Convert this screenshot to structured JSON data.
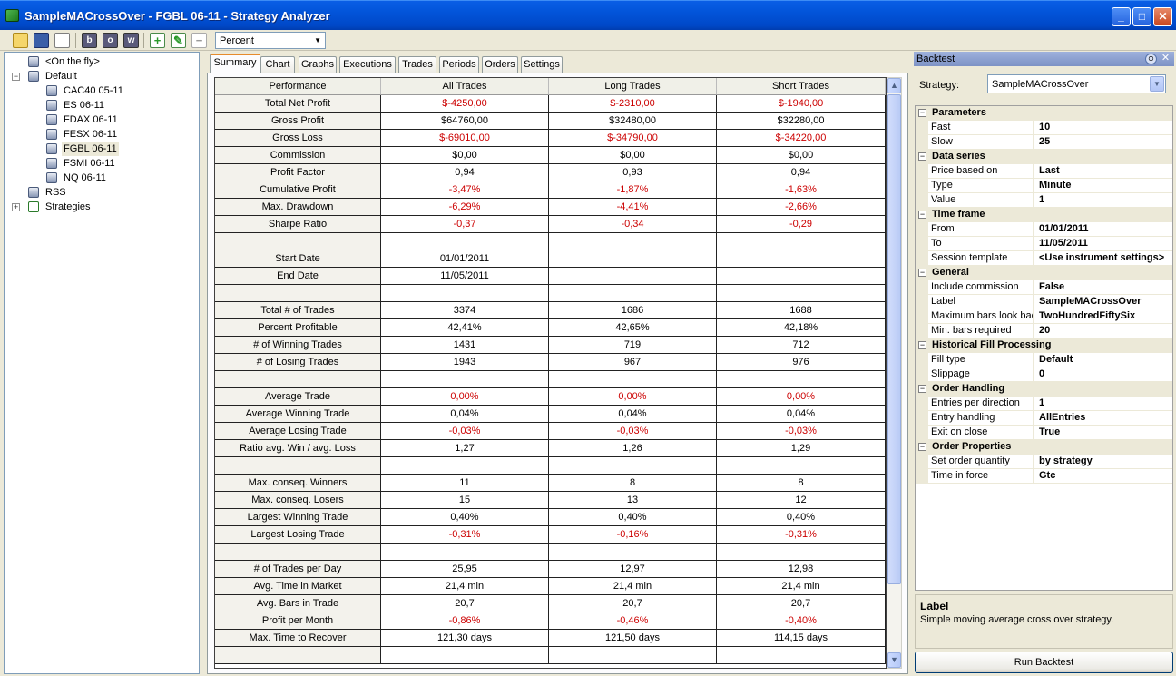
{
  "window": {
    "title": "SampleMACrossOver - FGBL 06-11 - Strategy Analyzer",
    "icon": "strategy-analyzer-icon",
    "controls": {
      "minimize": "_",
      "maximize": "□",
      "close": "✕"
    }
  },
  "toolbar": {
    "icons": [
      "open-folder-icon",
      "save-icon",
      "print-icon",
      "b-icon",
      "o-icon",
      "w-icon",
      "add-icon",
      "edit-icon",
      "remove-icon"
    ],
    "letters": {
      "b": "b",
      "o": "o",
      "w": "w",
      "add": "+",
      "edit": "✎",
      "remove": "−"
    },
    "display_select": {
      "value": "Percent",
      "arrow": "▼"
    }
  },
  "tree": {
    "expanders": {
      "default": "−",
      "strategies": "+"
    },
    "on_the_fly": "<On the fly>",
    "default": {
      "label": "Default",
      "items": [
        "CAC40 05-11",
        "ES 06-11",
        "FDAX 06-11",
        "FESX 06-11",
        "FGBL 06-11",
        "FSMI 06-11",
        "NQ 06-11"
      ],
      "selected": "FGBL 06-11"
    },
    "rss": "RSS",
    "strategies": "Strategies"
  },
  "tabs": [
    "Summary",
    "Chart",
    "Graphs",
    "Executions",
    "Trades",
    "Periods",
    "Orders",
    "Settings"
  ],
  "active_tab": "Summary",
  "summary": {
    "headers": [
      "Performance",
      "All Trades",
      "Long Trades",
      "Short Trades"
    ],
    "rows": [
      {
        "label": "Total Net Profit",
        "all": "$-4250,00",
        "long": "$-2310,00",
        "short": "$-1940,00",
        "neg": true
      },
      {
        "label": "Gross Profit",
        "all": "$64760,00",
        "long": "$32480,00",
        "short": "$32280,00"
      },
      {
        "label": "Gross Loss",
        "all": "$-69010,00",
        "long": "$-34790,00",
        "short": "$-34220,00",
        "neg": true
      },
      {
        "label": "Commission",
        "all": "$0,00",
        "long": "$0,00",
        "short": "$0,00"
      },
      {
        "label": "Profit Factor",
        "all": "0,94",
        "long": "0,93",
        "short": "0,94"
      },
      {
        "label": "Cumulative Profit",
        "all": "-3,47%",
        "long": "-1,87%",
        "short": "-1,63%",
        "neg": true
      },
      {
        "label": "Max. Drawdown",
        "all": "-6,29%",
        "long": "-4,41%",
        "short": "-2,66%",
        "neg": true
      },
      {
        "label": "Sharpe Ratio",
        "all": "-0,37",
        "long": "-0,34",
        "short": "-0,29",
        "neg": true
      },
      {
        "label": "",
        "all": "",
        "long": "",
        "short": ""
      },
      {
        "label": "Start Date",
        "all": "01/01/2011",
        "long": "",
        "short": ""
      },
      {
        "label": "End Date",
        "all": "11/05/2011",
        "long": "",
        "short": ""
      },
      {
        "label": "",
        "all": "",
        "long": "",
        "short": ""
      },
      {
        "label": "Total # of Trades",
        "all": "3374",
        "long": "1686",
        "short": "1688"
      },
      {
        "label": "Percent Profitable",
        "all": "42,41%",
        "long": "42,65%",
        "short": "42,18%"
      },
      {
        "label": "# of Winning Trades",
        "all": "1431",
        "long": "719",
        "short": "712"
      },
      {
        "label": "# of Losing Trades",
        "all": "1943",
        "long": "967",
        "short": "976"
      },
      {
        "label": "",
        "all": "",
        "long": "",
        "short": ""
      },
      {
        "label": "Average Trade",
        "all": "0,00%",
        "long": "0,00%",
        "short": "0,00%",
        "neg": true
      },
      {
        "label": "Average Winning Trade",
        "all": "0,04%",
        "long": "0,04%",
        "short": "0,04%"
      },
      {
        "label": "Average Losing Trade",
        "all": "-0,03%",
        "long": "-0,03%",
        "short": "-0,03%",
        "neg": true
      },
      {
        "label": "Ratio avg. Win / avg. Loss",
        "all": "1,27",
        "long": "1,26",
        "short": "1,29"
      },
      {
        "label": "",
        "all": "",
        "long": "",
        "short": ""
      },
      {
        "label": "Max. conseq. Winners",
        "all": "11",
        "long": "8",
        "short": "8"
      },
      {
        "label": "Max. conseq. Losers",
        "all": "15",
        "long": "13",
        "short": "12"
      },
      {
        "label": "Largest Winning Trade",
        "all": "0,40%",
        "long": "0,40%",
        "short": "0,40%"
      },
      {
        "label": "Largest Losing Trade",
        "all": "-0,31%",
        "long": "-0,16%",
        "short": "-0,31%",
        "neg": true
      },
      {
        "label": "",
        "all": "",
        "long": "",
        "short": ""
      },
      {
        "label": "# of Trades per Day",
        "all": "25,95",
        "long": "12,97",
        "short": "12,98"
      },
      {
        "label": "Avg. Time in Market",
        "all": "21,4 min",
        "long": "21,4 min",
        "short": "21,4 min"
      },
      {
        "label": "Avg. Bars in Trade",
        "all": "20,7",
        "long": "20,7",
        "short": "20,7"
      },
      {
        "label": "Profit per Month",
        "all": "-0,86%",
        "long": "-0,46%",
        "short": "-0,40%",
        "neg": true
      },
      {
        "label": "Max. Time to Recover",
        "all": "121,30 days",
        "long": "121,50 days",
        "short": "114,15 days"
      },
      {
        "label": "",
        "all": "",
        "long": "",
        "short": ""
      }
    ]
  },
  "scrollbar": {
    "up": "▲",
    "down": "▼"
  },
  "backtest": {
    "title": "Backtest",
    "pin": "⊙",
    "close": "✕",
    "strategy_label": "Strategy:",
    "strategy_value": "SampleMACrossOver",
    "strategy_arrow": "▼",
    "collapse_glyph": "−",
    "categories": [
      {
        "name": "Parameters",
        "props": [
          [
            "Fast",
            "10"
          ],
          [
            "Slow",
            "25"
          ]
        ]
      },
      {
        "name": "Data series",
        "props": [
          [
            "Price based on",
            "Last"
          ],
          [
            "Type",
            "Minute"
          ],
          [
            "Value",
            "1"
          ]
        ]
      },
      {
        "name": "Time frame",
        "props": [
          [
            "From",
            "01/01/2011"
          ],
          [
            "To",
            "11/05/2011"
          ],
          [
            "Session template",
            "<Use instrument settings>"
          ]
        ]
      },
      {
        "name": "General",
        "props": [
          [
            "Include commission",
            "False"
          ],
          [
            "Label",
            "SampleMACrossOver"
          ],
          [
            "Maximum bars look back",
            "TwoHundredFiftySix"
          ],
          [
            "Min. bars required",
            "20"
          ]
        ]
      },
      {
        "name": "Historical Fill Processing",
        "props": [
          [
            "Fill type",
            "Default"
          ],
          [
            "Slippage",
            "0"
          ]
        ]
      },
      {
        "name": "Order Handling",
        "props": [
          [
            "Entries per direction",
            "1"
          ],
          [
            "Entry handling",
            "AllEntries"
          ],
          [
            "Exit on close",
            "True"
          ]
        ]
      },
      {
        "name": "Order Properties",
        "props": [
          [
            "Set order quantity",
            "by strategy"
          ],
          [
            "Time in force",
            "Gtc"
          ]
        ]
      }
    ],
    "help_title": "Label",
    "help_desc": "Simple moving average cross over strategy.",
    "run_button": "Run Backtest"
  },
  "colors": {
    "negative": "#cc0000",
    "titlebar": "#0254d9",
    "active_tab_accent": "#e68b2c"
  }
}
